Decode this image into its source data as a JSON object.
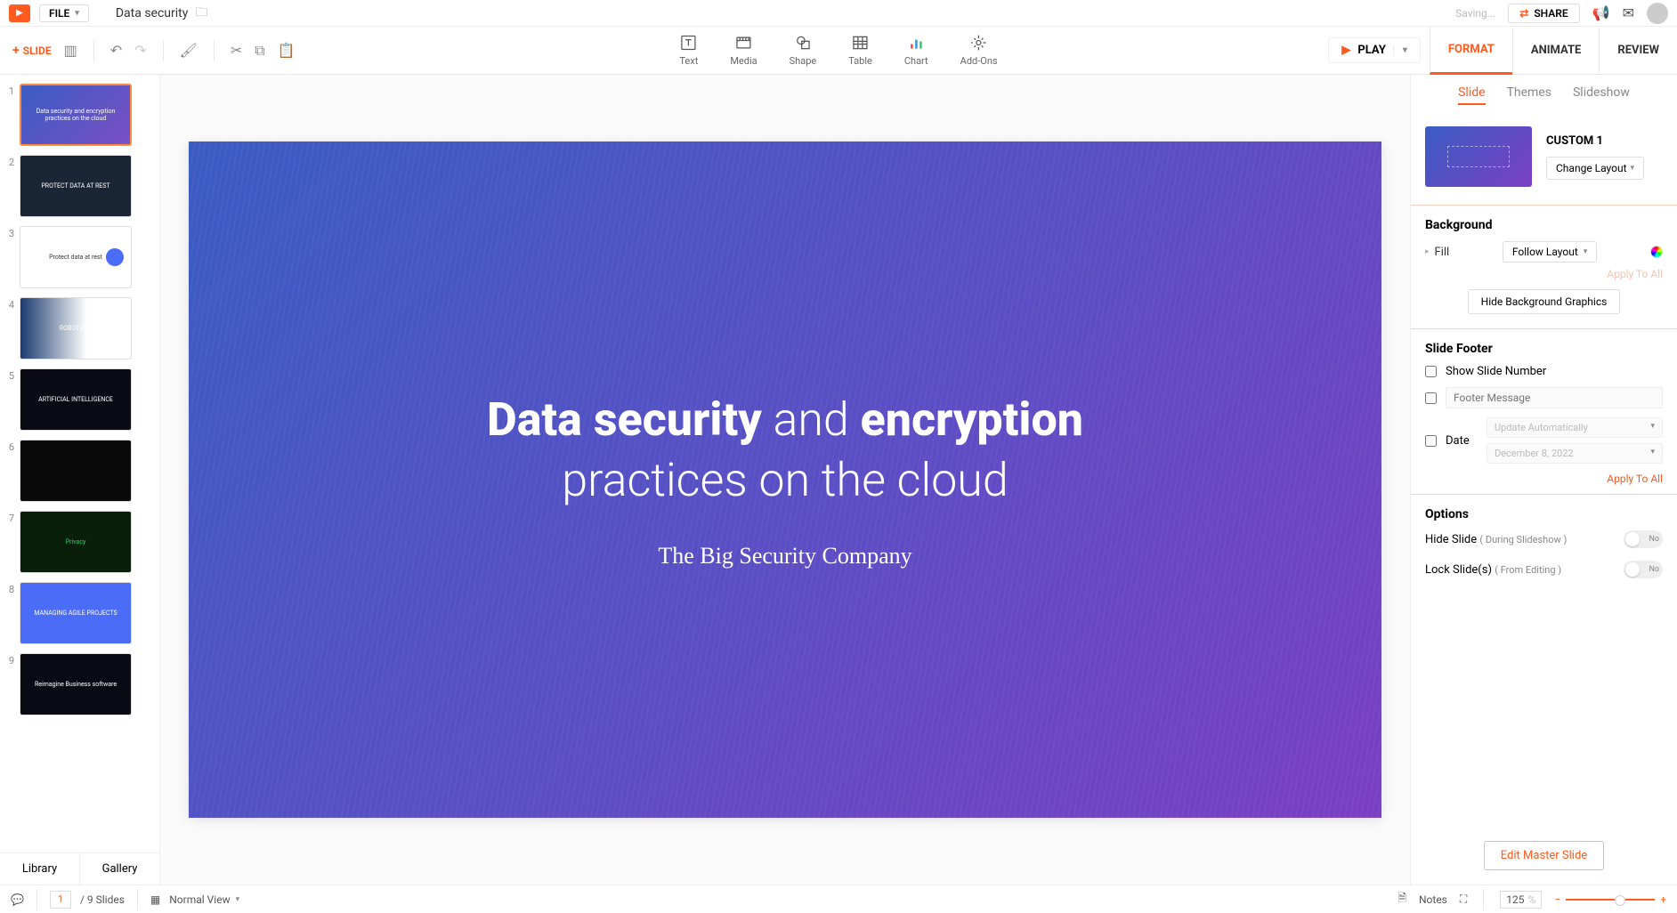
{
  "menubar": {
    "file_label": "FILE",
    "doc_title": "Data security",
    "saving_label": "Saving...",
    "share_label": "SHARE"
  },
  "toolbar": {
    "slide_label": "SLIDE",
    "center_items": [
      {
        "label": "Text"
      },
      {
        "label": "Media"
      },
      {
        "label": "Shape"
      },
      {
        "label": "Table"
      },
      {
        "label": "Chart"
      },
      {
        "label": "Add-Ons"
      }
    ],
    "play_label": "PLAY",
    "tabs": {
      "format": "FORMAT",
      "animate": "ANIMATE",
      "review": "REVIEW"
    }
  },
  "slides": {
    "items": [
      {
        "num": "1",
        "thumb_text": "Data security and encryption practices on the cloud"
      },
      {
        "num": "2",
        "thumb_text": "PROTECT DATA  AT REST"
      },
      {
        "num": "3",
        "thumb_text": "Protect data at rest"
      },
      {
        "num": "4",
        "thumb_text": "ROBOTICS?"
      },
      {
        "num": "5",
        "thumb_text": "ARTIFICIAL INTELLIGENCE"
      },
      {
        "num": "6",
        "thumb_text": ""
      },
      {
        "num": "7",
        "thumb_text": "Privacy"
      },
      {
        "num": "8",
        "thumb_text": "MANAGING AGILE PROJECTS"
      },
      {
        "num": "9",
        "thumb_text": "Reimagine Business software"
      }
    ],
    "library_label": "Library",
    "gallery_label": "Gallery"
  },
  "canvas": {
    "title_bold1": "Data security",
    "title_mid": " and ",
    "title_bold2": "encryption",
    "title_line2": "practices on the cloud",
    "subtitle": "The Big Security Company"
  },
  "sidebar": {
    "tabs": {
      "slide": "Slide",
      "themes": "Themes",
      "slideshow": "Slideshow"
    },
    "layout_name": "CUSTOM 1",
    "change_layout": "Change Layout",
    "background_head": "Background",
    "fill_label": "Fill",
    "fill_value": "Follow Layout",
    "apply_all": "Apply To All",
    "hide_bg": "Hide Background Graphics",
    "footer_head": "Slide Footer",
    "show_number": "Show Slide Number",
    "footer_placeholder": "Footer Message",
    "date_label": "Date",
    "date_update": "Update Automatically",
    "date_value": "December 8, 2022",
    "options_head": "Options",
    "hide_slide_label": "Hide Slide",
    "hide_slide_sub": "( During Slideshow )",
    "lock_slide_label": "Lock Slide(s)",
    "lock_slide_sub": "( From Editing )",
    "toggle_no": "No",
    "edit_master": "Edit Master Slide"
  },
  "statusbar": {
    "current_page": "1",
    "total_pages": "/ 9 Slides",
    "view_label": "Normal View",
    "notes_label": "Notes",
    "zoom_value": "125",
    "zoom_unit": "%"
  }
}
